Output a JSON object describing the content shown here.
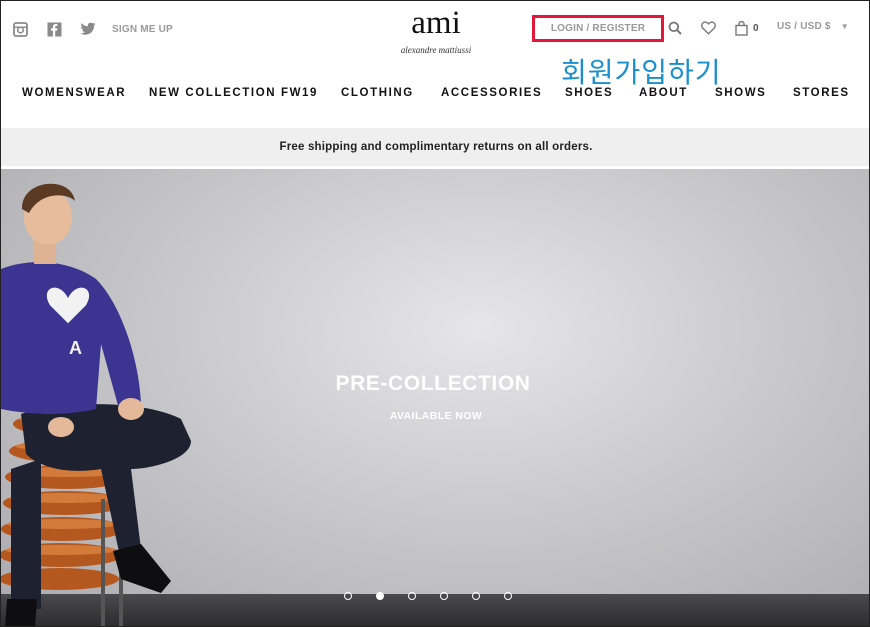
{
  "header": {
    "signup_label": "SIGN ME UP",
    "logo_main": "ami",
    "logo_sub": "alexandre mattiussi",
    "login_label": "LOGIN / REGISTER",
    "bag_count": "0",
    "currency_label": "US / USD $",
    "annotation_korean": "회원가입하기",
    "icons": [
      "instagram-icon",
      "facebook-icon",
      "twitter-icon",
      "search-icon",
      "heart-icon",
      "bag-icon",
      "chevron-down-icon"
    ],
    "highlight_color": "#e4163a",
    "annotation_color": "#1a8fd0"
  },
  "nav": {
    "items": [
      "WOMENSWEAR",
      "NEW COLLECTION FW19",
      "CLOTHING",
      "ACCESSORIES",
      "SHOES",
      "ABOUT",
      "SHOWS",
      "STORES"
    ]
  },
  "banner": {
    "text": "Free shipping and  complimentary returns on all orders."
  },
  "hero": {
    "title": "PRE-COLLECTION",
    "subtitle": "AVAILABLE NOW",
    "slide_count": 6,
    "active_slide": 2
  }
}
